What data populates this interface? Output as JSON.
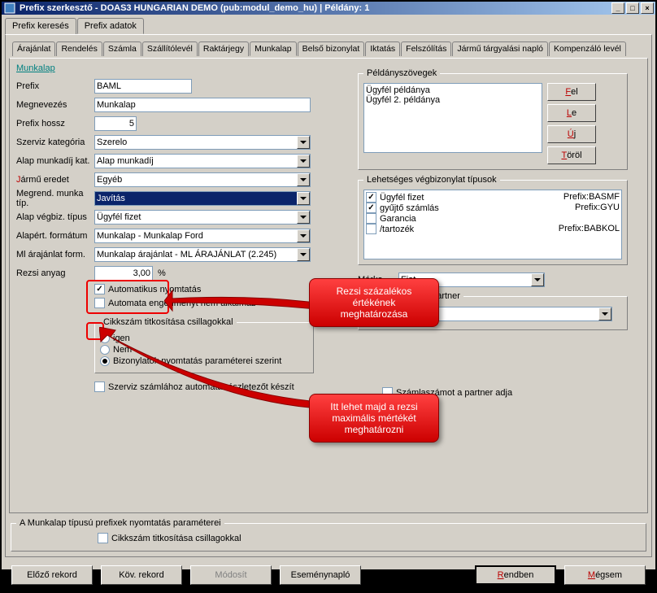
{
  "window": {
    "title": "Prefix szerkesztő - DOAS3 HUNGARIAN DEMO (pub:modul_demo_hu) | Példány: 1"
  },
  "top_tabs": [
    "Prefix keresés",
    "Prefix adatok"
  ],
  "active_top_tab": 1,
  "sub_tabs": [
    "Árajánlat",
    "Rendelés",
    "Számla",
    "Szállítólevél",
    "Raktárjegy",
    "Munkalap",
    "Belső bizonylat",
    "Iktatás",
    "Felszólítás",
    "Jármű tárgyalási napló",
    "Kompenzáló levél"
  ],
  "active_sub_tab": 5,
  "section": "Munkalap",
  "fields": {
    "prefix": {
      "label": "Prefix",
      "value": "BAML"
    },
    "megnevezes": {
      "label": "Megnevezés",
      "value": "Munkalap"
    },
    "prefix_hossz": {
      "label": "Prefix hossz",
      "value": "5"
    },
    "szerviz_kat": {
      "label": "Szerviz kategória",
      "value": "Szerelo"
    },
    "alap_munkadij": {
      "label": "Alap munkadíj kat.",
      "value": "Alap munkadíj"
    },
    "jarmu_eredet": {
      "label": "Jármű eredet",
      "value": "Egyéb",
      "required": true
    },
    "megrend_tip": {
      "label": "Megrend. munka típ.",
      "value": "Javítás"
    },
    "alap_vegbiz": {
      "label": "Alap végbiz. típus",
      "value": "Ügyfél fizet"
    },
    "alapert_format": {
      "label": "Alapért. formátum",
      "value": "Munkalap - Munkalap Ford"
    },
    "ml_arajanlat": {
      "label": "Ml árajánlat form.",
      "value": "Munkalap árajánlat - ML ÁRAJÁNLAT (2.245)"
    },
    "rezsi_anyag": {
      "label": "Rezsi anyag",
      "value": "3,00",
      "unit": "%"
    }
  },
  "checks": {
    "auto_nyomtatas": {
      "label": "Automatikus nyomtatás",
      "checked": true
    },
    "auto_engedmeny": {
      "label": "Automata engedményt nem alkalmaz",
      "checked": false
    },
    "szerviz_reszletezo": {
      "label": "Szerviz számlához automata részletezőt készít",
      "checked": false
    },
    "szamlaszam_partner": {
      "label": "Számlaszámot a partner adja",
      "checked": false
    },
    "cikkszam_low": {
      "label": "Cikkszám titkosítása csillagokkal",
      "checked": false
    }
  },
  "radiogroup": {
    "legend": "Cikkszám titkosítása csillagokkal",
    "options": [
      "igen",
      "Nem",
      "Bizonylatok nyomtatás paraméterei szerint"
    ],
    "selected": 2
  },
  "peldany": {
    "legend": "Példányszövegek",
    "items": [
      "Ügyfél példánya",
      "Ügyfél 2. példánya"
    ]
  },
  "peldany_buttons": {
    "fel": "Fel",
    "le": "Le",
    "uj": "Új",
    "torol": "Töröl"
  },
  "vegbiz": {
    "legend": "Lehetséges végbizonylat típusok",
    "items": [
      {
        "label": "Ügyfél fizet",
        "checked": true,
        "prefix": "Prefix:BASMF"
      },
      {
        "label": "gyűjtő számlás",
        "checked": true,
        "prefix": "Prefix:GYU"
      },
      {
        "label": "Garancia",
        "checked": false,
        "prefix": ""
      },
      {
        "label": "/tartozék",
        "checked": false,
        "prefix": "Prefix:BABKOL"
      }
    ]
  },
  "marka": {
    "label": "Márka",
    "value": "Fiat"
  },
  "garancia": {
    "legend": "Garanciát fizető partner",
    "nev_label": "Név",
    "nev_value": ""
  },
  "callout1": "Rezsi százalékos értékének meghatározása",
  "callout2": "Itt lehet majd a rezsi maximális mértékét meghatározni",
  "low_fieldset": "A Munkalap típusú prefixek nyomtatás paraméterei",
  "buttons": {
    "elozo": "Előző rekord",
    "kov": "Köv. rekord",
    "modosit": "Módosít",
    "esemeny": "Eseménynapló",
    "rendben": "Rendben",
    "megsem": "Mégsem"
  }
}
